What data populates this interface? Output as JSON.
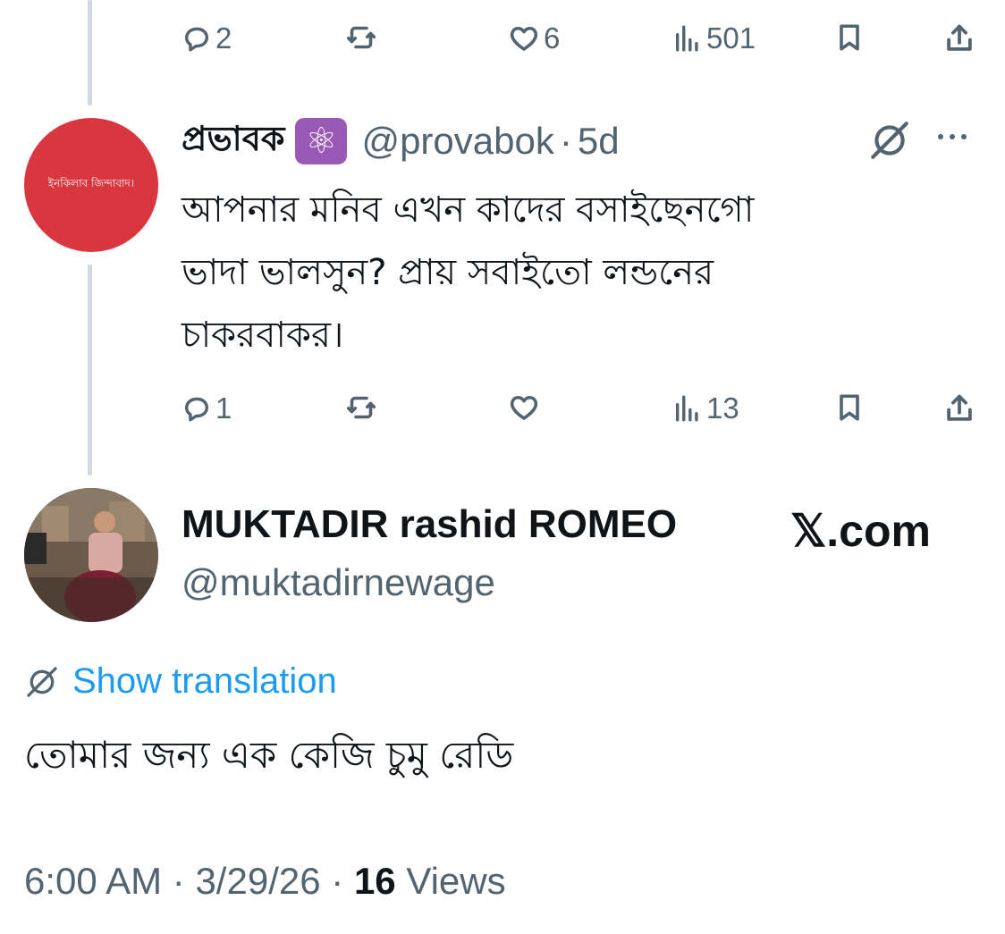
{
  "top_actions": {
    "replies": "2",
    "likes": "6",
    "views": "501"
  },
  "reply_tweet": {
    "avatar_text": "ইনকিলাব জিন্দাবাদ।",
    "display_name": "প্রভাবক",
    "emoji": "⚛",
    "handle": "@provabok",
    "sep": "·",
    "time": "5d",
    "lines": [
      "আপনার মনিব এখন কাদের বসাইছেনগো",
      "ভাদা ভালসুন? প্রায় সবাইতো লন্ডনের",
      "চাকরবাকর।"
    ],
    "actions": {
      "replies": "1",
      "likes": "",
      "views": "13"
    }
  },
  "main_tweet": {
    "display_name": "MUKTADIR rashid ROMEO",
    "handle": "@muktadirnewage",
    "watermark": "𝕏.com",
    "translate_label": "Show translation",
    "text": "তোমার জন্য এক কেজি চুমু রেডি",
    "time": "6:00 AM",
    "dot1": "·",
    "date": "3/29/26",
    "dot2": "·",
    "views_count": "16",
    "views_label": "Views"
  },
  "colors": {
    "link": "#1d9bf0",
    "muted": "#536471",
    "avatar_red": "#d93640",
    "line": "#cfd9de"
  }
}
